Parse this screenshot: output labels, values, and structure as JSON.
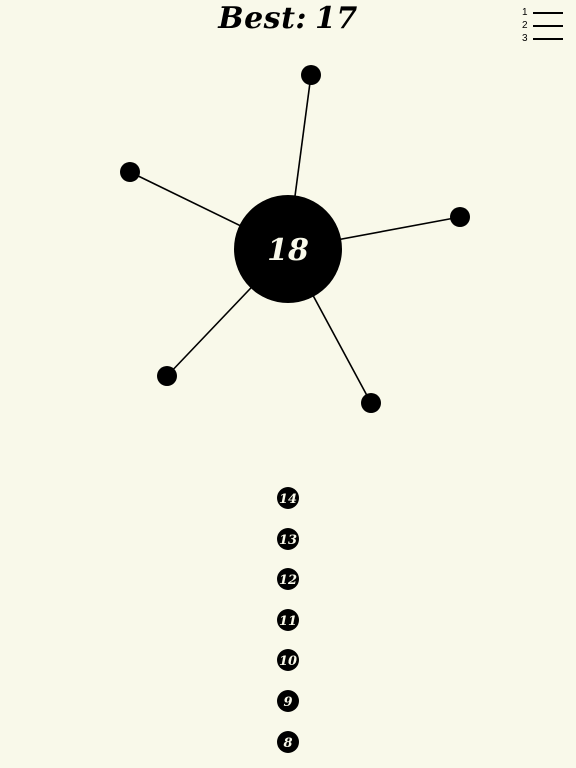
{
  "header": {
    "best_label": "Best:",
    "best_value": "17"
  },
  "menu": {
    "items": [
      "1",
      "2",
      "3"
    ]
  },
  "hub": {
    "count": "18"
  },
  "pins": {
    "stuck_count": 5
  },
  "queue": {
    "balls": [
      "14",
      "13",
      "12",
      "11",
      "10",
      "9",
      "8"
    ]
  },
  "colors": {
    "background": "#f9f9ea",
    "ink": "#000000"
  }
}
